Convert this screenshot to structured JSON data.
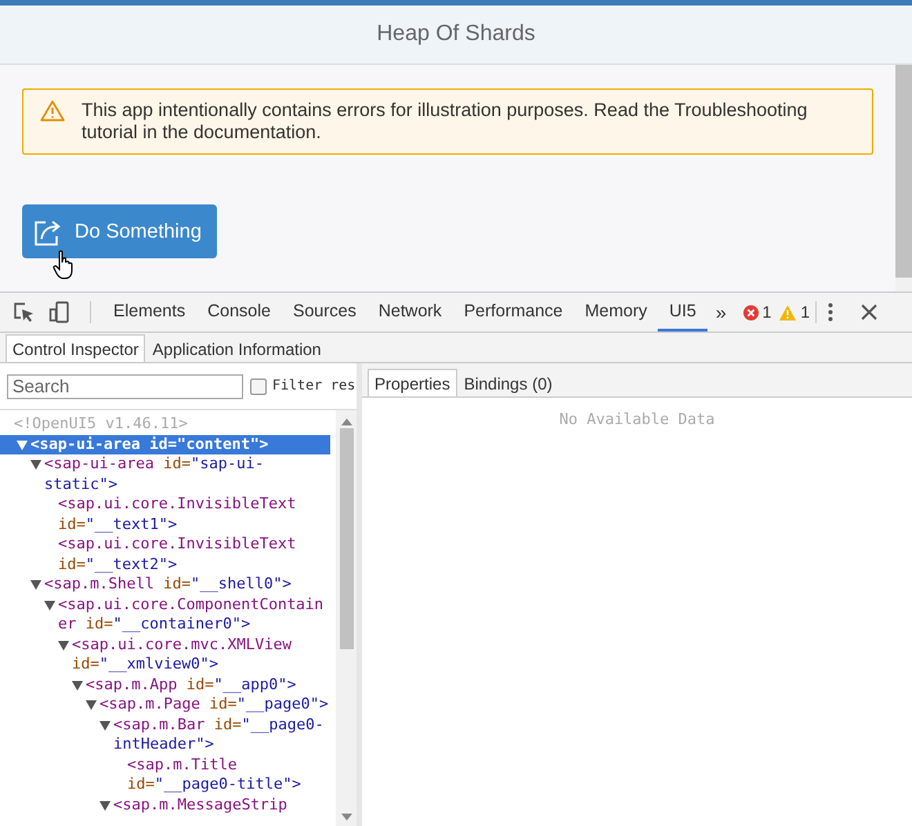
{
  "app": {
    "title": "Heap Of Shards",
    "message_strip": {
      "text": "This app intentionally contains errors for illustration purposes. Read the Troubleshooting tutorial in the documentation."
    },
    "button": {
      "label": "Do Something"
    }
  },
  "devtools": {
    "tabs": [
      {
        "label": "Elements",
        "selected": false
      },
      {
        "label": "Console",
        "selected": false
      },
      {
        "label": "Sources",
        "selected": false
      },
      {
        "label": "Network",
        "selected": false
      },
      {
        "label": "Performance",
        "selected": false
      },
      {
        "label": "Memory",
        "selected": false
      },
      {
        "label": "UI5",
        "selected": true
      }
    ],
    "more": "»",
    "errors": "1",
    "warnings": "1",
    "panel_tabs": [
      {
        "label": "Control Inspector",
        "selected": true
      },
      {
        "label": "Application Information",
        "selected": false
      }
    ],
    "search": {
      "placeholder": "Search"
    },
    "filter": {
      "label": "Filter res",
      "checked": false
    },
    "tree": {
      "header": "<!OpenUI5 v1.46.11>",
      "nodes": [
        {
          "text": "<sap-ui-area id=\"content\">",
          "expanded": true,
          "selected": true,
          "children": [
            {
              "text": "<sap-ui-area id=\"sap-ui-static\">",
              "expanded": true,
              "selected": false,
              "children": [
                {
                  "text": "<sap.ui.core.InvisibleText id=\"__text1\">",
                  "selected": false
                },
                {
                  "text": "<sap.ui.core.InvisibleText id=\"__text2\">",
                  "selected": false
                }
              ]
            },
            {
              "text": "<sap.m.Shell id=\"__shell0\">",
              "expanded": true,
              "selected": false,
              "children": [
                {
                  "text": "<sap.ui.core.ComponentContainer id=\"__container0\">",
                  "expanded": true,
                  "selected": false,
                  "children": [
                    {
                      "text": "<sap.ui.core.mvc.XMLView id=\"__xmlview0\">",
                      "expanded": true,
                      "selected": false,
                      "children": [
                        {
                          "text": "<sap.m.App id=\"__app0\">",
                          "expanded": true,
                          "selected": false,
                          "children": [
                            {
                              "text": "<sap.m.Page id=\"__page0\">",
                              "expanded": true,
                              "selected": false,
                              "children": [
                                {
                                  "text": "<sap.m.Bar id=\"__page0-intHeader\">",
                                  "expanded": true,
                                  "selected": false,
                                  "children": [
                                    {
                                      "text": "<sap.m.Title id=\"__page0-title\">",
                                      "selected": false
                                    }
                                  ]
                                },
                                {
                                  "text": "<sap.m.MessageStrip",
                                  "expanded": true,
                                  "selected": false
                                }
                              ]
                            }
                          ]
                        }
                      ]
                    }
                  ]
                }
              ]
            }
          ]
        }
      ]
    },
    "detail_tabs": [
      {
        "label": "Properties",
        "selected": true
      },
      {
        "label": "Bindings (0)",
        "selected": false
      }
    ],
    "empty_text": "No Available Data"
  }
}
